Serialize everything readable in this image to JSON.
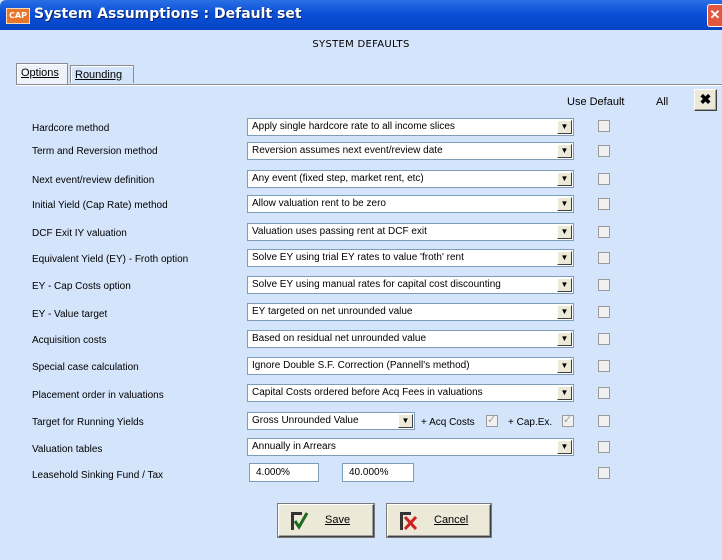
{
  "window": {
    "title": "System Assumptions : Default set",
    "app_icon": "CAP",
    "close_glyph": "✕"
  },
  "subtitle": "SYSTEM DEFAULTS",
  "tabs": [
    {
      "label": "Options"
    },
    {
      "label": "Rounding"
    }
  ],
  "headers": {
    "use_default": "Use Default",
    "all": "All",
    "clear_glyph": "✖"
  },
  "rows": [
    {
      "label": "Hardcore method",
      "value": "Apply single hardcore rate to all income slices",
      "use_default": false
    },
    {
      "label": "Term and Reversion method",
      "value": "Reversion assumes next event/review date",
      "use_default": false
    },
    {
      "label": "Next event/review definition",
      "value": "Any event (fixed step, market rent, etc)",
      "use_default": false
    },
    {
      "label": "Initial Yield (Cap Rate) method",
      "value": "Allow valuation rent to be zero",
      "use_default": false
    },
    {
      "label": "DCF Exit IY valuation",
      "value": "Valuation uses passing rent at DCF exit",
      "use_default": false
    },
    {
      "label": "Equivalent Yield (EY) - Froth option",
      "value": "Solve EY using trial EY rates to value 'froth' rent",
      "use_default": false
    },
    {
      "label": "EY - Cap Costs option",
      "value": "Solve EY using manual rates for capital cost discounting",
      "use_default": false
    },
    {
      "label": "EY - Value target",
      "value": "EY targeted on net unrounded value",
      "use_default": false
    },
    {
      "label": "Acquisition costs",
      "value": "Based on residual net unrounded value",
      "use_default": false
    },
    {
      "label": "Special case calculation",
      "value": "Ignore Double S.F. Correction (Pannell's method)",
      "use_default": false
    },
    {
      "label": "Placement order in valuations",
      "value": "Capital Costs ordered before Acq Fees in valuations",
      "use_default": false
    },
    {
      "label": "Target for Running Yields",
      "value": "Gross Unrounded Value",
      "use_default": false,
      "acq_costs_label": "+ Acq Costs",
      "acq_costs_checked": true,
      "cap_ex_label": "+ Cap.Ex.",
      "cap_ex_checked": true
    },
    {
      "label": "Valuation tables",
      "value": "Annually in Arrears",
      "use_default": false
    },
    {
      "label": "Leasehold Sinking Fund / Tax",
      "rate": "4.000%",
      "tax": "40.000%",
      "use_default": false
    }
  ],
  "buttons": {
    "save": "Save",
    "cancel": "Cancel"
  },
  "colors": {
    "titlebar": "#0a4fd8",
    "background": "#d4e4fb",
    "close": "#e1583f"
  }
}
